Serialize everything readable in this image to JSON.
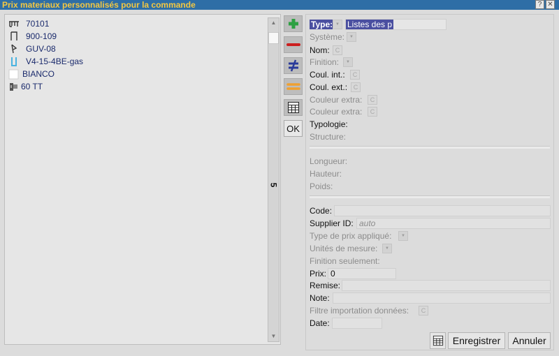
{
  "window": {
    "title": "Prix materiaux personnalisés pour la commande",
    "help_label": "?",
    "close_label": "✕"
  },
  "list": {
    "items": [
      {
        "label": "70101",
        "icon": "profile-icon"
      },
      {
        "label": "900-109",
        "icon": "profile-icon"
      },
      {
        "label": "GUV-08",
        "icon": "profile-icon"
      },
      {
        "label": "V4-15-4BE-gas",
        "icon": "gasket-icon"
      },
      {
        "label": "BIANCO",
        "icon": "color-swatch-icon"
      },
      {
        "label": "60 TT",
        "icon": "hardware-icon"
      }
    ],
    "count": "5"
  },
  "toolbar": {
    "ok_label": "OK"
  },
  "form": {
    "type_label": "Type:",
    "type_value": "Listes des p",
    "systeme_label": "Système:",
    "nom_label": "Nom:",
    "finition_label": "Finition:",
    "coul_int_label": "Coul. int.:",
    "coul_ext_label": "Coul. ext.:",
    "couleur_extra1_label": "Couleur extra:",
    "couleur_extra2_label": "Couleur extra:",
    "typologie_label": "Typologie:",
    "structure_label": "Structure:",
    "longueur_label": "Longueur:",
    "hauteur_label": "Hauteur:",
    "poids_label": "Poids:",
    "code_label": "Code:",
    "code_value": "",
    "supplier_label": "Supplier ID:",
    "supplier_placeholder": "auto",
    "type_prix_label": "Type de prix appliqué:",
    "unites_label": "Unités de mesure:",
    "finition_seulement_label": "Finition seulement:",
    "prix_label": "Prix:",
    "prix_value": "0",
    "remise_label": "Remise:",
    "remise_value": "",
    "note_label": "Note:",
    "note_value": "",
    "filtre_label": "Filtre importation données:",
    "date_label": "Date:",
    "date_value": "",
    "c_button_label": "C"
  },
  "footer": {
    "save_label": "Enregistrer",
    "cancel_label": "Annuler"
  },
  "colors": {
    "titlebar": "#2e6ea6",
    "title_text": "#f4c842",
    "highlight": "#4a4fa0",
    "plus": "#2ea043",
    "minus": "#cc1f1f"
  }
}
